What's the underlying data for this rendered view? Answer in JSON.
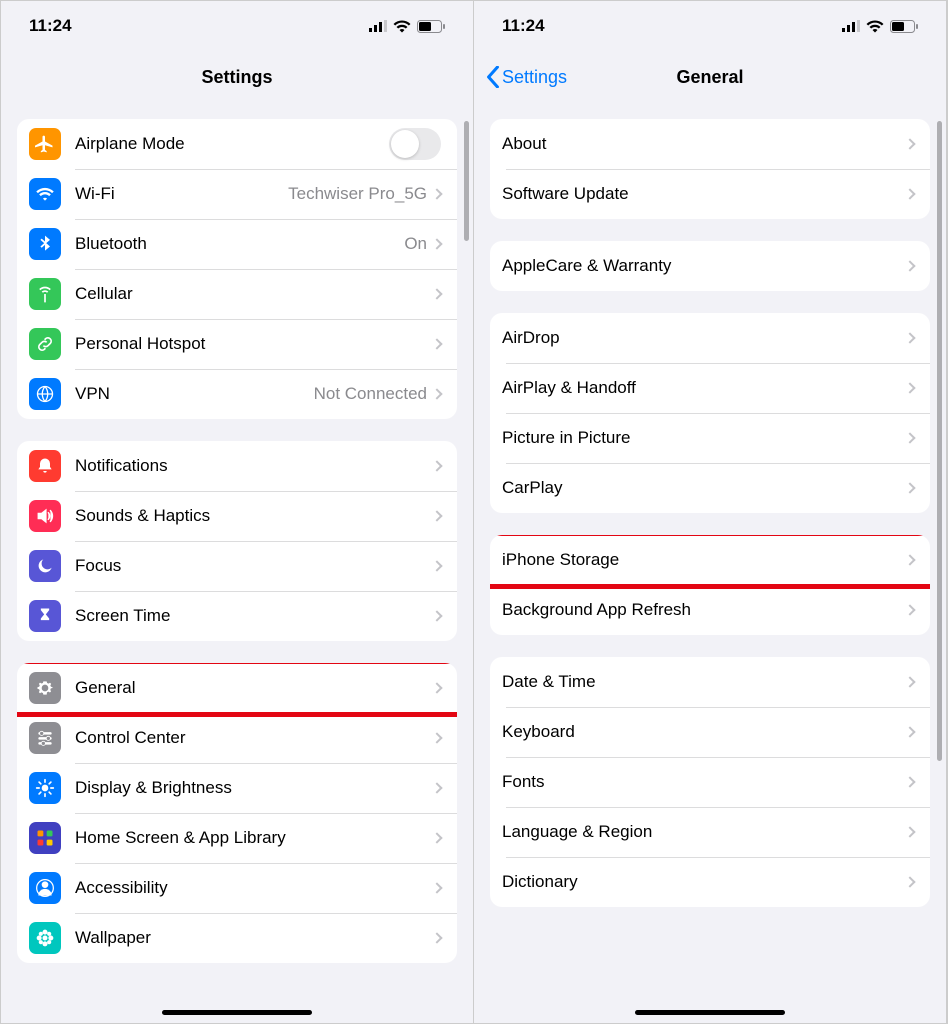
{
  "status": {
    "time": "11:24"
  },
  "left": {
    "title": "Settings",
    "groups": [
      [
        {
          "id": "airplane",
          "label": "Airplane Mode",
          "icon": "airplane",
          "color": "#ff9500",
          "toggle": true
        },
        {
          "id": "wifi",
          "label": "Wi-Fi",
          "value": "Techwiser Pro_5G",
          "icon": "wifi",
          "color": "#007aff"
        },
        {
          "id": "bluetooth",
          "label": "Bluetooth",
          "value": "On",
          "icon": "bluetooth",
          "color": "#007aff"
        },
        {
          "id": "cellular",
          "label": "Cellular",
          "icon": "antenna",
          "color": "#34c759"
        },
        {
          "id": "hotspot",
          "label": "Personal Hotspot",
          "icon": "link",
          "color": "#34c759"
        },
        {
          "id": "vpn",
          "label": "VPN",
          "value": "Not Connected",
          "icon": "globe",
          "color": "#007aff"
        }
      ],
      [
        {
          "id": "notifications",
          "label": "Notifications",
          "icon": "bell",
          "color": "#ff3b30"
        },
        {
          "id": "sounds",
          "label": "Sounds & Haptics",
          "icon": "speaker",
          "color": "#ff2d55"
        },
        {
          "id": "focus",
          "label": "Focus",
          "icon": "moon",
          "color": "#5856d6"
        },
        {
          "id": "screentime",
          "label": "Screen Time",
          "icon": "hourglass",
          "color": "#5856d6"
        }
      ],
      [
        {
          "id": "general",
          "label": "General",
          "icon": "gear",
          "color": "#8e8e93",
          "highlight": true
        },
        {
          "id": "controlcenter",
          "label": "Control Center",
          "icon": "sliders",
          "color": "#8e8e93"
        },
        {
          "id": "display",
          "label": "Display & Brightness",
          "icon": "sun",
          "color": "#007aff"
        },
        {
          "id": "homescreen",
          "label": "Home Screen & App Library",
          "icon": "grid",
          "color": "#4040c0"
        },
        {
          "id": "accessibility",
          "label": "Accessibility",
          "icon": "person",
          "color": "#007aff"
        },
        {
          "id": "wallpaper",
          "label": "Wallpaper",
          "icon": "flower",
          "color": "#00c7be"
        }
      ]
    ]
  },
  "right": {
    "back": "Settings",
    "title": "General",
    "groups": [
      [
        {
          "id": "about",
          "label": "About"
        },
        {
          "id": "software",
          "label": "Software Update"
        }
      ],
      [
        {
          "id": "applecare",
          "label": "AppleCare & Warranty"
        }
      ],
      [
        {
          "id": "airdrop",
          "label": "AirDrop"
        },
        {
          "id": "airplay",
          "label": "AirPlay & Handoff"
        },
        {
          "id": "pip",
          "label": "Picture in Picture"
        },
        {
          "id": "carplay",
          "label": "CarPlay"
        }
      ],
      [
        {
          "id": "storage",
          "label": "iPhone Storage",
          "highlight": true
        },
        {
          "id": "bgrefresh",
          "label": "Background App Refresh"
        }
      ],
      [
        {
          "id": "datetime",
          "label": "Date & Time"
        },
        {
          "id": "keyboard",
          "label": "Keyboard"
        },
        {
          "id": "fonts",
          "label": "Fonts"
        },
        {
          "id": "language",
          "label": "Language & Region"
        },
        {
          "id": "dictionary",
          "label": "Dictionary"
        }
      ]
    ]
  }
}
